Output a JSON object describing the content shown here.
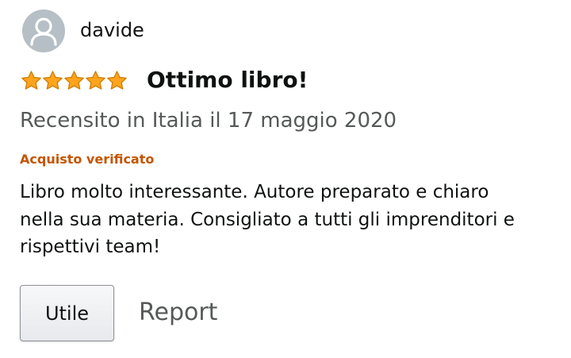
{
  "reviewer": {
    "name": "davide",
    "avatar_icon": "user-avatar-icon"
  },
  "review": {
    "rating": 5,
    "rating_max": 5,
    "star_color": "#ffa41c",
    "title": "Ottimo libro!",
    "date_text": "Recensito in Italia il 17 maggio 2020",
    "verified_label": "Acquisto verificato",
    "verified_color": "#c45500",
    "body": "Libro molto interessante. Autore preparato e chiaro\nnella sua materia. Consigliato a tutti gli imprenditori e\nrispettivi team!"
  },
  "actions": {
    "helpful_label": "Utile",
    "report_label": "Report"
  }
}
